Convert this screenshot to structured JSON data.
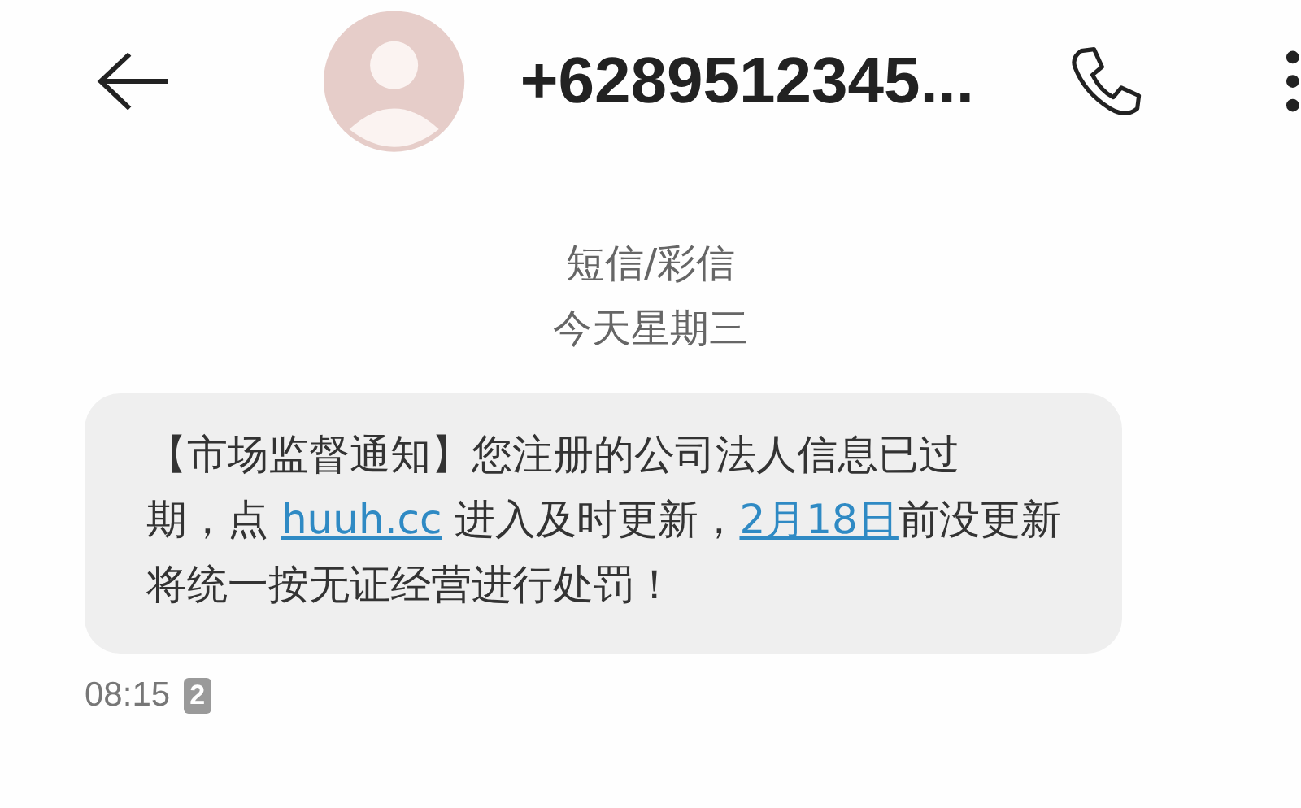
{
  "header": {
    "contact": "+6289512345..."
  },
  "conversation": {
    "channel": "短信/彩信",
    "day": "今天星期三"
  },
  "message": {
    "lines": [
      [
        {
          "kind": "text",
          "text": "【市场监督通知】您注册的公司法人信息已过"
        }
      ],
      [
        {
          "kind": "text",
          "text": "期，点 "
        },
        {
          "kind": "link",
          "text": "huuh.cc"
        },
        {
          "kind": "text",
          "text": " 进入及时更新，"
        },
        {
          "kind": "link",
          "text": "2月18日"
        },
        {
          "kind": "text",
          "text": "前没更新"
        }
      ],
      [
        {
          "kind": "text",
          "text": "将统一按无证经营进行处罚！"
        }
      ]
    ],
    "time": "08:15",
    "sim_slot": "2"
  }
}
